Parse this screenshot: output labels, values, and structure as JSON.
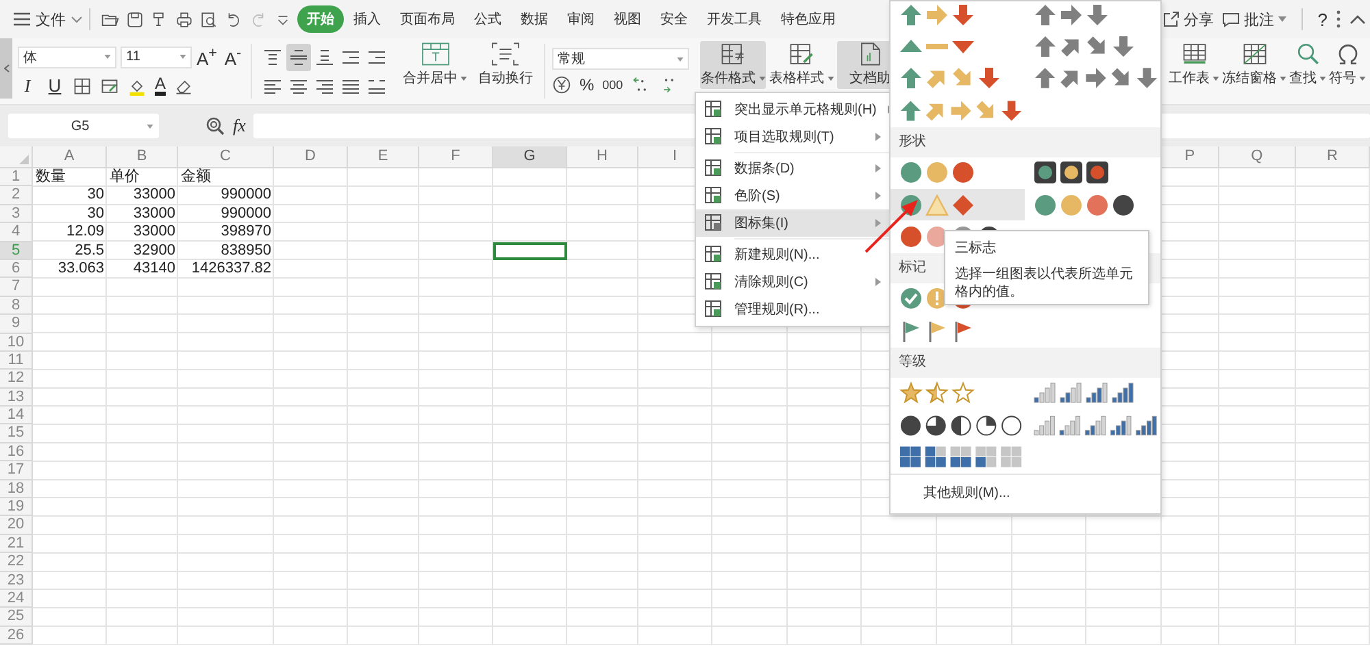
{
  "topbar": {
    "file_menu": "文件",
    "tabs": [
      {
        "label": "开始",
        "selected": true
      },
      {
        "label": "插入",
        "selected": false
      },
      {
        "label": "页面布局",
        "selected": false
      },
      {
        "label": "公式",
        "selected": false
      },
      {
        "label": "数据",
        "selected": false
      },
      {
        "label": "审阅",
        "selected": false
      },
      {
        "label": "视图",
        "selected": false
      },
      {
        "label": "安全",
        "selected": false
      },
      {
        "label": "开发工具",
        "selected": false
      },
      {
        "label": "特色应用",
        "selected": false
      }
    ],
    "share": "分享",
    "comment": "批注",
    "help": "?"
  },
  "ribbon": {
    "font_name": "体",
    "font_size": "11",
    "size_buttons": [
      "A$^{+}$",
      "A$^{-}$"
    ],
    "style_buttons": [
      "I",
      "U"
    ],
    "color_button": "A",
    "align_buttons": [
      {
        "selected": false
      },
      {
        "selected": true
      },
      {
        "selected": false
      },
      {
        "selected": false
      },
      {
        "selected": false
      },
      {
        "selected": false
      },
      {
        "selected": false
      },
      {
        "selected": false
      },
      {
        "selected": false
      },
      {
        "selected": false
      }
    ],
    "merge": "合并居中",
    "wrap": "自动换行",
    "number_format": "常规",
    "percent": "%",
    "thousands": "000",
    "big_buttons": [
      {
        "label": "条件格式",
        "kind": "rules",
        "dropdown": true,
        "selected": true
      },
      {
        "label": "表格样式",
        "kind": "table",
        "dropdown": true,
        "selected": false
      },
      {
        "label": "文档助",
        "kind": "doc",
        "dropdown": false,
        "selected": true
      }
    ],
    "right_buttons": [
      {
        "label": "工作表",
        "kind": "sheet"
      },
      {
        "label": "冻结窗格",
        "kind": "freeze"
      },
      {
        "label": "查找",
        "kind": "search"
      },
      {
        "label": "符号",
        "kind": "symbol"
      }
    ]
  },
  "formula_bar": {
    "cell_ref": "G5",
    "fx": "fx"
  },
  "sheet": {
    "columns": [
      {
        "label": "A",
        "selected": false
      },
      {
        "label": "B",
        "selected": false
      },
      {
        "label": "C",
        "selected": false
      },
      {
        "label": "D",
        "selected": false
      },
      {
        "label": "E",
        "selected": false
      },
      {
        "label": "F",
        "selected": false
      },
      {
        "label": "G",
        "selected": true
      },
      {
        "label": "H",
        "selected": false
      },
      {
        "label": "I",
        "selected": false
      },
      {
        "label": "P",
        "selected": false
      },
      {
        "label": "Q",
        "selected": false
      },
      {
        "label": "R",
        "selected": false
      }
    ],
    "rows": [
      {
        "num": "1",
        "selected": false,
        "kind": "text",
        "cells": [
          "数量",
          "单价",
          "金额"
        ]
      },
      {
        "num": "2",
        "selected": false,
        "kind": "number",
        "cells": [
          "30",
          "33000",
          "990000"
        ]
      },
      {
        "num": "3",
        "selected": false,
        "kind": "number",
        "cells": [
          "30",
          "33000",
          "990000"
        ]
      },
      {
        "num": "4",
        "selected": false,
        "kind": "number",
        "cells": [
          "12.09",
          "33000",
          "398970"
        ]
      },
      {
        "num": "5",
        "selected": true,
        "kind": "number",
        "cells": [
          "25.5",
          "32900",
          "838950"
        ]
      },
      {
        "num": "6",
        "selected": false,
        "kind": "number",
        "cells": [
          "33.063",
          "43140",
          "1426337.82"
        ]
      },
      {
        "num": "7",
        "selected": false
      },
      {
        "num": "8",
        "selected": false
      },
      {
        "num": "9",
        "selected": false
      },
      {
        "num": "10",
        "selected": false
      },
      {
        "num": "11",
        "selected": false
      },
      {
        "num": "12",
        "selected": false
      },
      {
        "num": "13",
        "selected": false
      },
      {
        "num": "14",
        "selected": false
      },
      {
        "num": "15",
        "selected": false
      },
      {
        "num": "16",
        "selected": false
      },
      {
        "num": "17",
        "selected": false
      },
      {
        "num": "18",
        "selected": false
      },
      {
        "num": "19",
        "selected": false
      },
      {
        "num": "20",
        "selected": false
      },
      {
        "num": "21",
        "selected": false
      },
      {
        "num": "22",
        "selected": false
      },
      {
        "num": "23",
        "selected": false
      },
      {
        "num": "24",
        "selected": false
      },
      {
        "num": "25",
        "selected": false
      },
      {
        "num": "26",
        "selected": false
      }
    ]
  },
  "menu": {
    "items": [
      {
        "label": "突出显示单元格规则(H)",
        "submenu": true,
        "selected": false,
        "divider_above": false
      },
      {
        "label": "项目选取规则(T)",
        "submenu": true,
        "selected": false,
        "divider_above": false
      },
      {
        "label": "数据条(D)",
        "submenu": true,
        "selected": false,
        "divider_above": true
      },
      {
        "label": "色阶(S)",
        "submenu": true,
        "selected": false,
        "divider_above": false
      },
      {
        "label": "图标集(I)",
        "submenu": true,
        "selected": true,
        "divider_above": false
      },
      {
        "label": "新建规则(N)...",
        "submenu": false,
        "selected": false,
        "divider_above": true
      },
      {
        "label": "清除规则(C)",
        "submenu": true,
        "selected": false,
        "divider_above": false
      },
      {
        "label": "管理规则(R)...",
        "submenu": false,
        "selected": false,
        "divider_above": false
      }
    ]
  },
  "icon_panel": {
    "sections": [
      {
        "sets": [
          {
            "kind": "arrows3",
            "selected": false
          },
          {
            "kind": "arrows3-gray",
            "selected": false
          },
          {
            "kind": "triangles3",
            "selected": false
          },
          {
            "kind": "arrows4-gray",
            "selected": false
          },
          {
            "kind": "arrows4",
            "selected": false
          },
          {
            "kind": "arrows5-gray",
            "selected": false
          },
          {
            "kind": "arrows5",
            "selected": false
          }
        ]
      },
      {
        "title": "形状",
        "sets": [
          {
            "kind": "circles3",
            "selected": false
          },
          {
            "kind": "traffic3",
            "selected": false
          },
          {
            "kind": "shapes3",
            "selected": true
          },
          {
            "kind": "circles4",
            "selected": false
          },
          {
            "kind": "circles4-red",
            "selected": false
          }
        ]
      },
      {
        "title": "标记",
        "sets": [
          {
            "kind": "symbols3",
            "selected": false
          },
          {
            "kind": "flags3",
            "selected": false
          }
        ]
      },
      {
        "title": "等级",
        "sets": [
          {
            "kind": "stars3",
            "selected": false
          },
          {
            "kind": "bars4",
            "selected": false
          },
          {
            "kind": "quarters5",
            "selected": false
          },
          {
            "kind": "bars5",
            "selected": false
          },
          {
            "kind": "boxes5",
            "selected": false
          }
        ]
      }
    ],
    "footer": "其他规则(M)..."
  },
  "tooltip": {
    "title": "三标志",
    "text": "选择一组图表以代表所选单元格内的值。"
  }
}
